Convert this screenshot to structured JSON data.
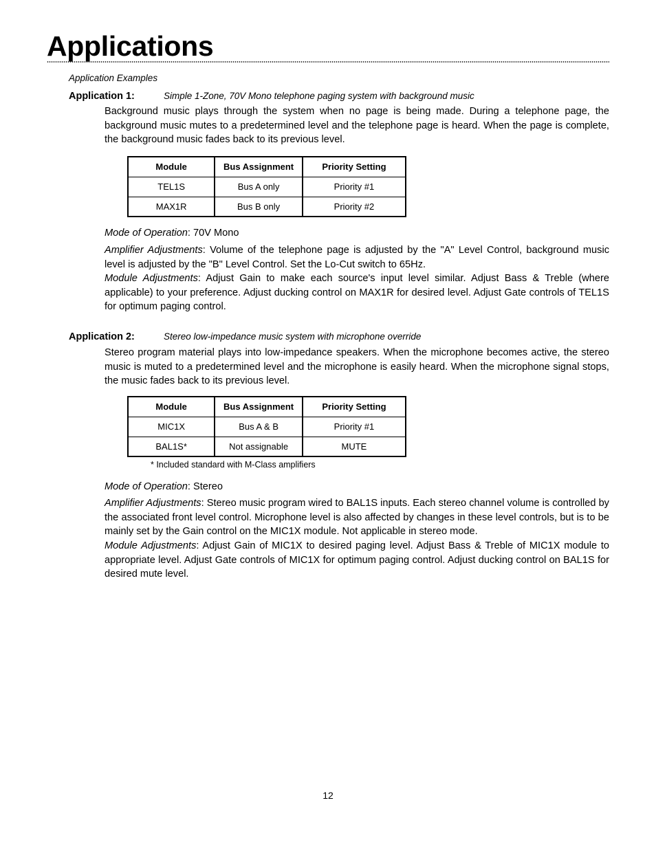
{
  "document": {
    "title": "Applications",
    "section_label": "Application Examples",
    "page_number": "12"
  },
  "applications": [
    {
      "number_label": "Application 1:",
      "description": "Simple  1-Zone, 70V Mono telephone paging system with background music",
      "intro": "Background music plays through the system when no page is being made. During a telephone page, the background music mutes to a predetermined level and the telephone page is heard. When the page is complete, the background music fades back to its previous level.",
      "table": {
        "headers": [
          "Module",
          "Bus Assignment",
          "Priority Setting"
        ],
        "rows": [
          [
            "TEL1S",
            "Bus A only",
            "Priority #1"
          ],
          [
            "MAX1R",
            "Bus B only",
            "Priority #2"
          ]
        ],
        "note": ""
      },
      "mode_label": "Mode of Operation",
      "mode_value": ": 70V Mono",
      "amp_label": "Amplifier Adjustments",
      "amp_value": ": Volume of the telephone page is adjusted by the \"A\" Level Control, background music level is adjusted by the \"B\" Level Control. Set the Lo-Cut switch to 65Hz.",
      "module_label": "Module Adjustments",
      "module_value": ": Adjust Gain to make each source's input level similar. Adjust Bass & Treble (where applicable) to your preference. Adjust ducking control on MAX1R for desired level. Adjust Gate controls of TEL1S for optimum paging control."
    },
    {
      "number_label": "Application 2:",
      "description": "Stereo low-impedance music system with microphone override",
      "intro": "Stereo program material plays into low-impedance speakers. When the microphone becomes active, the stereo music is muted to a predetermined level and the microphone is easily heard. When the microphone signal stops, the music fades back to its previous level.",
      "table": {
        "headers": [
          "Module",
          "Bus Assignment",
          "Priority Setting"
        ],
        "rows": [
          [
            "MIC1X",
            "Bus A & B",
            "Priority #1"
          ],
          [
            "BAL1S*",
            "Not assignable",
            "MUTE"
          ]
        ],
        "note": "* Included standard with M-Class amplifiers"
      },
      "mode_label": "Mode of Operation",
      "mode_value": ": Stereo",
      "amp_label": "Amplifier Adjustments",
      "amp_value": ": Stereo music program wired to BAL1S inputs. Each stereo channel volume is controlled by the associated front level control. Microphone level is also affected by changes in these level controls, but is to be mainly set by the Gain control on the MIC1X module. Not applicable in stereo mode.",
      "module_label": "Module Adjustments",
      "module_value": ": Adjust Gain of MIC1X to desired paging level. Adjust Bass & Treble of MIC1X module to appropriate level. Adjust Gate controls of MIC1X for optimum paging control.  Adjust ducking control on BAL1S for desired mute level."
    }
  ]
}
